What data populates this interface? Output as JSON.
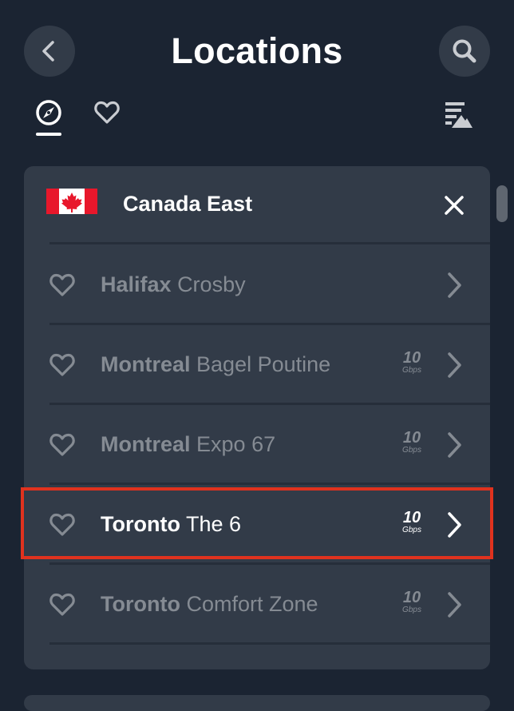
{
  "header": {
    "title": "Locations"
  },
  "region": {
    "name": "Canada East"
  },
  "locations": [
    {
      "city": "Halifax",
      "name": "Crosby",
      "speed": "",
      "speed_unit": ""
    },
    {
      "city": "Montreal",
      "name": "Bagel Poutine",
      "speed": "10",
      "speed_unit": "Gbps"
    },
    {
      "city": "Montreal",
      "name": "Expo 67",
      "speed": "10",
      "speed_unit": "Gbps"
    },
    {
      "city": "Toronto",
      "name": "The 6",
      "speed": "10",
      "speed_unit": "Gbps"
    },
    {
      "city": "Toronto",
      "name": "Comfort Zone",
      "speed": "10",
      "speed_unit": "Gbps"
    }
  ],
  "icons": {
    "back": "chevron-left-icon",
    "search": "search-icon",
    "explore_tab": "compass-icon",
    "favorites_tab": "heart-icon",
    "sort": "sort-filter-icon",
    "close": "close-icon",
    "favorite": "heart-outline-icon",
    "row_arrow": "chevron-right-icon"
  },
  "colors": {
    "background": "#1b2432",
    "panel": "#323b48",
    "text_primary": "#ffffff",
    "text_muted": "#858b93",
    "highlight_border": "#e0321e",
    "flag_red": "#e8172b"
  },
  "state": {
    "selected_location_index": 3,
    "active_tab": "explore"
  }
}
